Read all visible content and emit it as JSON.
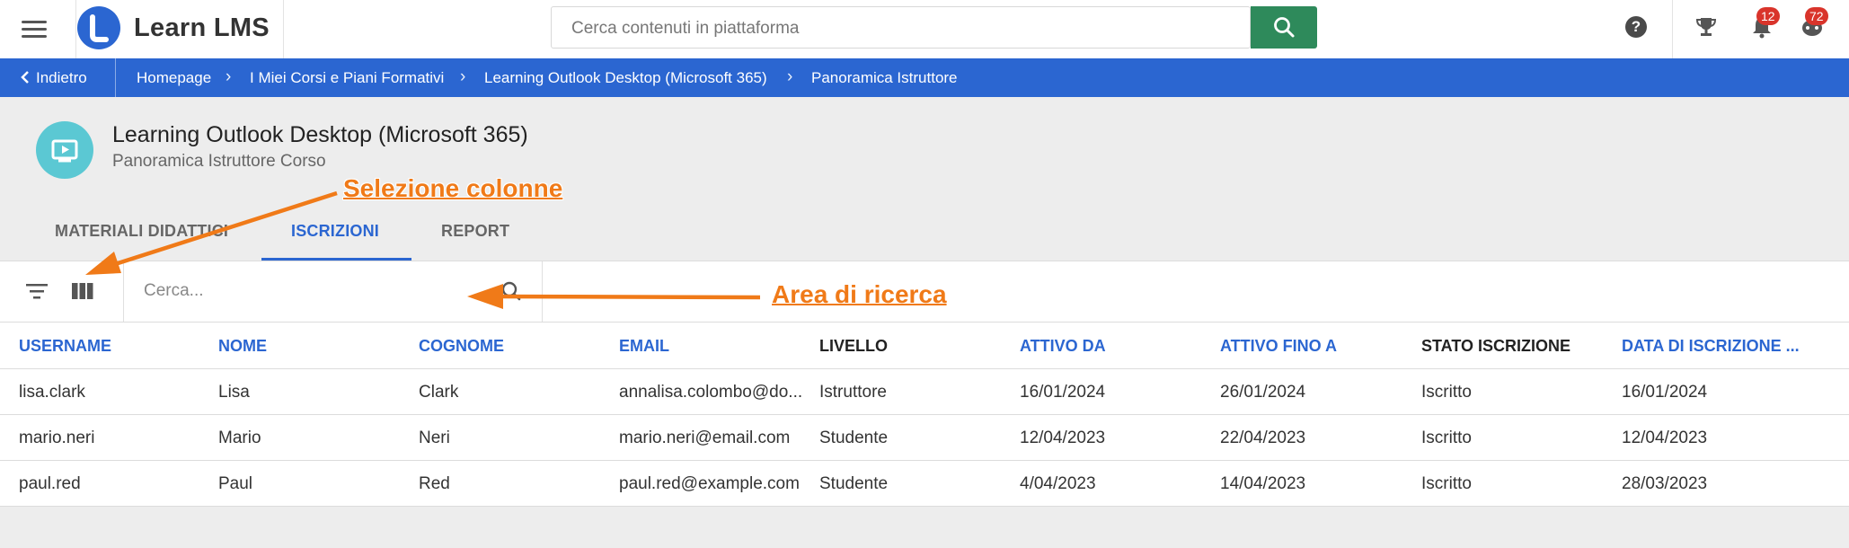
{
  "app": {
    "brand": "Learn LMS"
  },
  "search": {
    "placeholder": "Cerca contenuti in piattaforma"
  },
  "notifications": {
    "bell_count": "12",
    "messages_count": "72"
  },
  "breadcrumb": {
    "back": "Indietro",
    "items": [
      "Homepage",
      "I Miei Corsi e Piani Formativi",
      "Learning Outlook Desktop (Microsoft 365)",
      "Panoramica Istruttore"
    ]
  },
  "course": {
    "title": "Learning Outlook Desktop (Microsoft 365)",
    "subtitle": "Panoramica Istruttore Corso"
  },
  "tabs": [
    {
      "label": "MATERIALI DIDATTICI",
      "active": false
    },
    {
      "label": "ISCRIZIONI",
      "active": true
    },
    {
      "label": "REPORT",
      "active": false
    }
  ],
  "table_search": {
    "placeholder": "Cerca..."
  },
  "table": {
    "columns": [
      "USERNAME",
      "NOME",
      "COGNOME",
      "EMAIL",
      "LIVELLO",
      "ATTIVO DA",
      "ATTIVO FINO A",
      "STATO ISCRIZIONE",
      "DATA DI ISCRIZIONE ..."
    ],
    "rows": [
      [
        "lisa.clark",
        "Lisa",
        "Clark",
        "annalisa.colombo@do...",
        "Istruttore",
        "16/01/2024",
        "26/01/2024",
        "Iscritto",
        "16/01/2024"
      ],
      [
        "mario.neri",
        "Mario",
        "Neri",
        "mario.neri@email.com",
        "Studente",
        "12/04/2023",
        "22/04/2023",
        "Iscritto",
        "12/04/2023"
      ],
      [
        "paul.red",
        "Paul",
        "Red",
        "paul.red@example.com",
        "Studente",
        "4/04/2023",
        "14/04/2023",
        "Iscritto",
        "28/03/2023"
      ]
    ]
  },
  "annotations": {
    "columns": "Selezione colonne",
    "search": "Area di ricerca"
  },
  "colors": {
    "brand_blue": "#2b66d1",
    "search_green": "#2e8a5b",
    "course_icon": "#5bc8d3",
    "badge_red": "#d9342b",
    "annotation_orange": "#f07a18"
  }
}
